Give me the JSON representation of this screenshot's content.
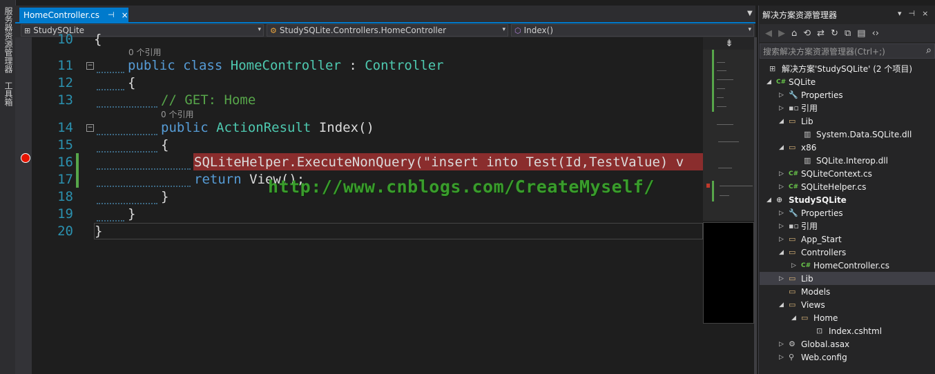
{
  "left_strip": {
    "tab1": "服务器资源管理器",
    "tab2": "工具箱"
  },
  "tab": {
    "name": "HomeController.cs",
    "pin": "⊣",
    "close": "×"
  },
  "nav": {
    "project": "StudySQLite",
    "class": "StudySQLite.Controllers.HomeController",
    "member": "Index()"
  },
  "code": {
    "lines": [
      "10",
      "11",
      "12",
      "13",
      "14",
      "15",
      "16",
      "17",
      "18",
      "19",
      "20"
    ],
    "lens": "0 个引用",
    "l10": "{",
    "l11_kw1": "public",
    "l11_kw2": "class",
    "l11_type": "HomeController",
    "l11_sep": " : ",
    "l11_base": "Controller",
    "l12": "{",
    "l13": "// GET: Home",
    "l14_kw": "public",
    "l14_type": "ActionResult",
    "l14_name": "Index()",
    "l15": "{",
    "l16_call": "SQLiteHelper.ExecuteNonQuery(",
    "l16_str": "\"insert into Test(Id,TestValue) v",
    "l17_kw": "return",
    "l17_rest": " View();",
    "l18": "}",
    "l19": "}",
    "l20": "}"
  },
  "watermark": "http://www.cnblogs.com/CreateMyself/",
  "solution_explorer": {
    "title": "解决方案资源管理器",
    "search_placeholder": "搜索解决方案资源管理器(Ctrl+;)",
    "tree": [
      "解决方案'StudySQLite' (2 个项目)",
      "SQLite",
      "Properties",
      "引用",
      "Lib",
      "System.Data.SQLite.dll",
      "x86",
      "SQLite.Interop.dll",
      "SQLiteContext.cs",
      "SQLiteHelper.cs",
      "StudySQLite",
      "Properties",
      "引用",
      "App_Start",
      "Controllers",
      "HomeController.cs",
      "Lib",
      "Models",
      "Views",
      "Home",
      "Index.cshtml",
      "Global.asax",
      "Web.config"
    ]
  },
  "colors": {
    "accent": "#007acc",
    "keyword": "#569cd6",
    "type": "#4ec9b0",
    "comment": "#57a64a",
    "breakpoint": "#e51400",
    "highlight": "#8a2d2d"
  }
}
